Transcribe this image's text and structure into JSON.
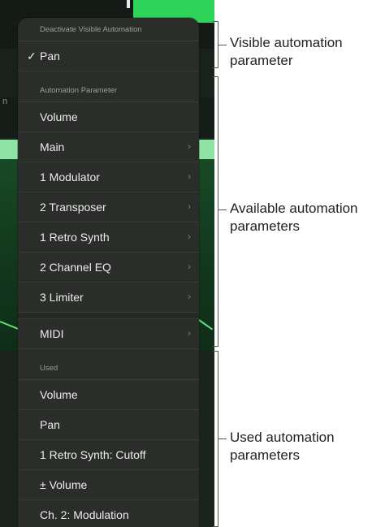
{
  "menu": {
    "visible_section": {
      "header": "Deactivate Visible Automation",
      "items": [
        {
          "label": "Pan",
          "checked": true,
          "check_glyph": "✓"
        }
      ]
    },
    "parameters_section": {
      "header": "Automation Parameter",
      "items": [
        {
          "label": "Volume",
          "has_submenu": false
        },
        {
          "label": "Main",
          "has_submenu": true
        },
        {
          "label": "1 Modulator",
          "has_submenu": true
        },
        {
          "label": "2 Transposer",
          "has_submenu": true
        },
        {
          "label": "1 Retro Synth",
          "has_submenu": true
        },
        {
          "label": "2 Channel EQ",
          "has_submenu": true
        },
        {
          "label": "3 Limiter",
          "has_submenu": true
        },
        {
          "label": "MIDI",
          "has_submenu": true
        }
      ],
      "chevron_glyph": "›"
    },
    "used_section": {
      "header": "Used",
      "items": [
        {
          "label": "Volume"
        },
        {
          "label": "Pan"
        },
        {
          "label": "1 Retro Synth: Cutoff"
        },
        {
          "label": "± Volume"
        },
        {
          "label": "Ch. 2: Modulation"
        }
      ]
    }
  },
  "callouts": {
    "visible": "Visible automation parameter",
    "available": "Available automation parameters",
    "used": "Used automation parameters"
  },
  "background": {
    "partial_label": "n"
  },
  "colors": {
    "menu_bg": "#2b2d2b",
    "menu_text": "#ececec",
    "header_text": "#9c9e9c",
    "accent_green": "#2ed35a"
  }
}
